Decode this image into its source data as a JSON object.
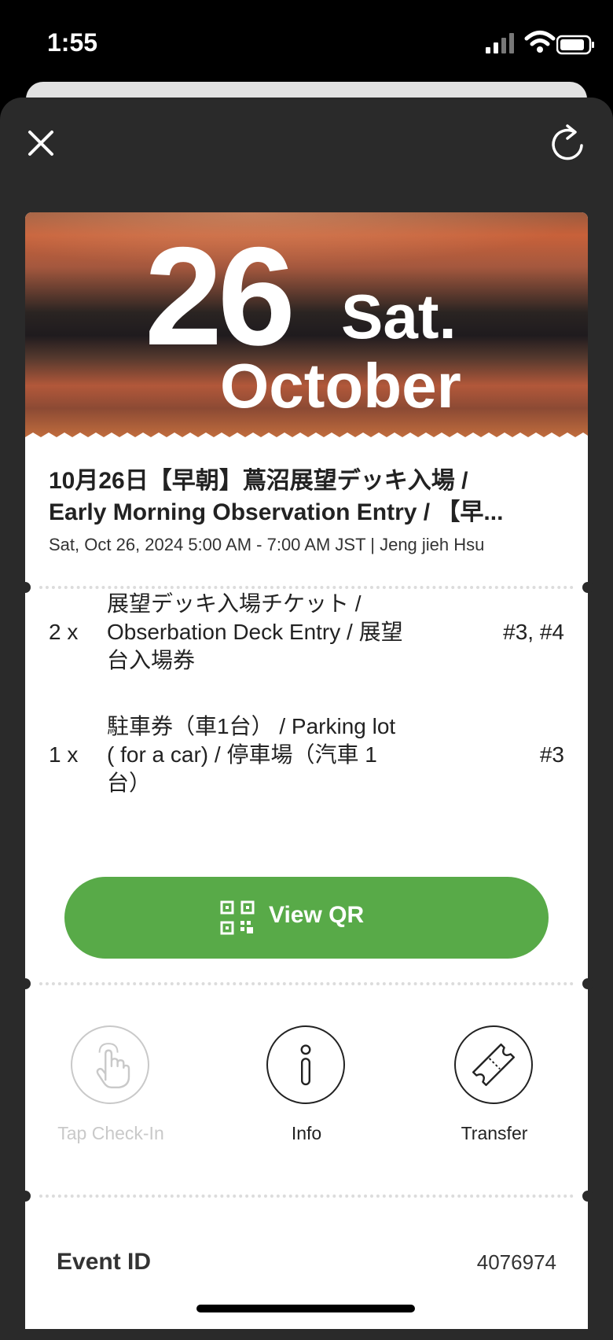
{
  "status_bar": {
    "time": "1:55"
  },
  "header": {
    "close_icon": "close-icon",
    "refresh_icon": "refresh-icon"
  },
  "hero": {
    "day": "26",
    "weekday": "Sat.",
    "month": "October"
  },
  "event": {
    "title_line1": "10月26日【早朝】蔦沼展望デッキ入場 /",
    "title_line2": "Early Morning Observation Entry / 【早...",
    "subtitle": "Sat, Oct 26, 2024 5:00 AM - 7:00 AM JST | Jeng jieh Hsu"
  },
  "tickets": [
    {
      "qty": "2 x",
      "name_lines": [
        "展望デッキ入場チケット /",
        "Obserbation Deck Entry / 展望",
        "台入場券"
      ],
      "seats": "#3, #4"
    },
    {
      "qty": "1 x",
      "name_lines": [
        "駐車券（車1台） / Parking lot",
        "( for a car) / 停車場（汽車 1",
        "台）"
      ],
      "seats": "#3"
    }
  ],
  "qr_button": {
    "label": "View QR",
    "icon": "qr-code-icon"
  },
  "actions": [
    {
      "label": "Tap Check-In",
      "icon": "tap-hand-icon",
      "enabled": false
    },
    {
      "label": "Info",
      "icon": "info-icon",
      "enabled": true
    },
    {
      "label": "Transfer",
      "icon": "ticket-icon",
      "enabled": true
    }
  ],
  "event_id": {
    "label": "Event ID",
    "value": "4076974"
  },
  "colors": {
    "accent_green": "#58aa48",
    "sheet_bg": "#2a2a2a",
    "disabled": "#c9c9c9"
  }
}
